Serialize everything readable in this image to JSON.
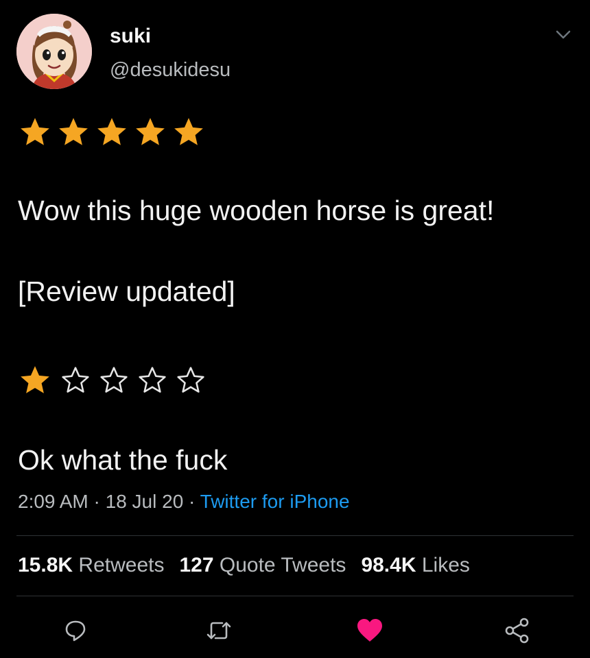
{
  "user": {
    "display_name": "suki",
    "handle": "@desukidesu"
  },
  "ratings": {
    "first": {
      "value": 5,
      "max": 5
    },
    "second": {
      "value": 1,
      "max": 5
    }
  },
  "tweet": {
    "line1": "Wow this huge wooden horse is great!",
    "line2": "[Review updated]",
    "line3": "Ok what the fuck"
  },
  "meta": {
    "time": "2:09 AM",
    "sep1": " · ",
    "date": "18 Jul 20",
    "sep2": " · ",
    "source": "Twitter for iPhone"
  },
  "stats": {
    "retweets_count": "15.8K",
    "retweets_label": "Retweets",
    "quotes_count": "127",
    "quotes_label": "Quote Tweets",
    "likes_count": "98.4K",
    "likes_label": "Likes"
  },
  "colors": {
    "star": "#f5a623",
    "link": "#1d9bf0",
    "like": "#f91880",
    "background": "#000000"
  },
  "icons": {
    "reply": "reply-icon",
    "retweet": "retweet-icon",
    "like": "heart-icon",
    "share": "share-icon",
    "menu": "chevron-down-icon"
  }
}
